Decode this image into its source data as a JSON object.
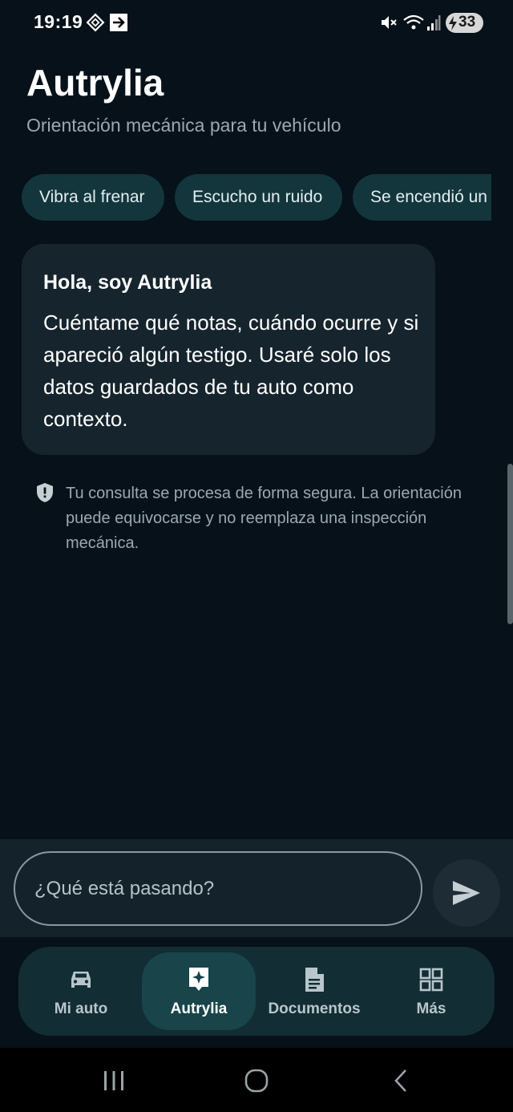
{
  "status_bar": {
    "time": "19:19",
    "battery": "33",
    "icons": [
      "nfc-icon",
      "cast-icon",
      "mute-icon",
      "wifi-icon",
      "signal-icon",
      "battery-charging-icon"
    ]
  },
  "header": {
    "title": "Autrylia",
    "subtitle": "Orientación mecánica para tu vehículo"
  },
  "suggestion_chips": [
    {
      "label": "Vibra al frenar"
    },
    {
      "label": "Escucho un ruido"
    },
    {
      "label": "Se encendió un testigo"
    }
  ],
  "greeting_card": {
    "title": "Hola, soy Autrylia",
    "body": "Cuéntame qué notas, cuándo ocurre y si apareció algún testigo. Usaré solo los datos guardados de tu auto como contexto."
  },
  "notice": {
    "icon": "shield-icon",
    "text": "Tu consulta se procesa de forma segura. La orientación puede equivocarse y no reemplaza una inspección mecánica."
  },
  "composer": {
    "placeholder": "¿Qué está pasando?",
    "send_icon": "send-icon"
  },
  "bottom_nav": {
    "items": [
      {
        "label": "Mi auto",
        "icon": "car-icon",
        "active": false
      },
      {
        "label": "Autrylia",
        "icon": "sparkle-icon",
        "active": true
      },
      {
        "label": "Documentos",
        "icon": "document-icon",
        "active": false
      },
      {
        "label": "Más",
        "icon": "grid-icon",
        "active": false
      }
    ]
  },
  "colors": {
    "background": "#061119",
    "chip": "#13363d",
    "card": "#16242d",
    "nav_active": "#18444a",
    "muted_text": "#9aa9b1"
  }
}
